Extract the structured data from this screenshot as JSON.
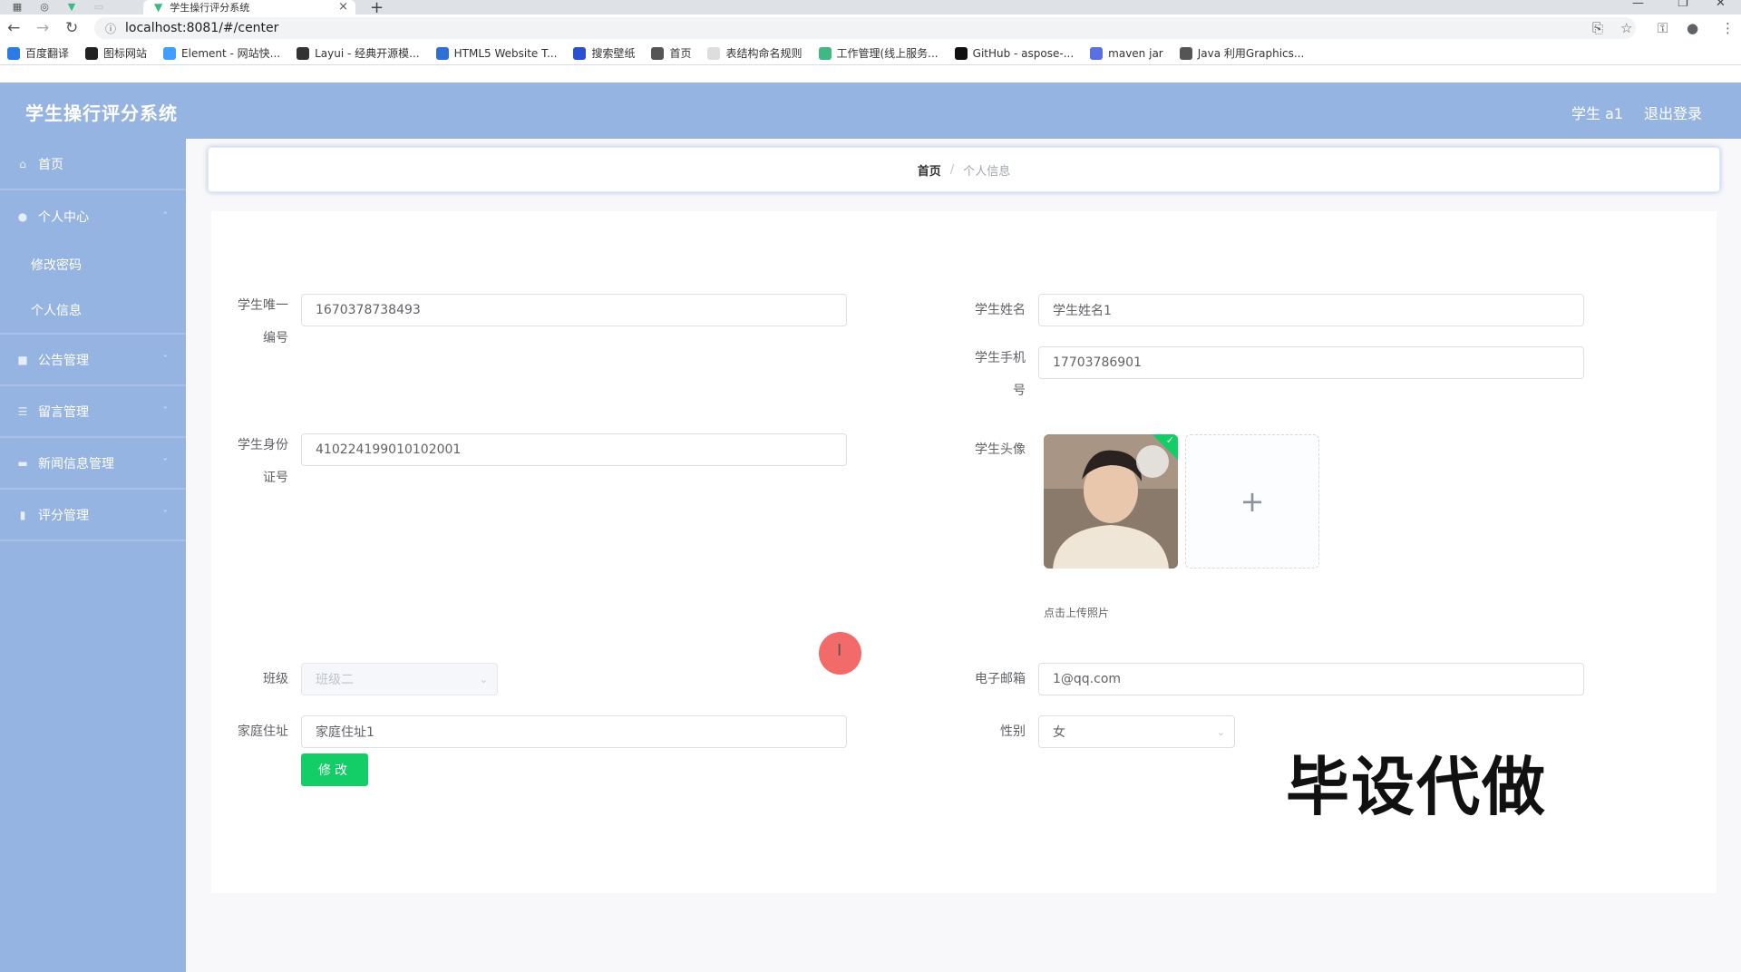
{
  "browser": {
    "tab_title": "学生操行评分系统",
    "url": "localhost:8081/#/center",
    "bookmarks": [
      {
        "label": "百度翻译",
        "icon": "translate-icon",
        "color": "#2c7be5"
      },
      {
        "label": "图标网站",
        "icon": "image-icon",
        "color": "#222222"
      },
      {
        "label": "Element - 网站快...",
        "icon": "element-icon",
        "color": "#409eff"
      },
      {
        "label": "Layui - 经典开源模...",
        "icon": "layui-icon",
        "color": "#333333"
      },
      {
        "label": "HTML5 Website T...",
        "icon": "html5-icon",
        "color": "#2f6fd6"
      },
      {
        "label": "搜索壁纸",
        "icon": "wallpaper-icon",
        "color": "#2a4fcf"
      },
      {
        "label": "首页",
        "icon": "globe-icon",
        "color": "#555555"
      },
      {
        "label": "表结构命名规则",
        "icon": "page-icon",
        "color": "#dddddd"
      },
      {
        "label": "工作管理(线上服务...",
        "icon": "vue-icon",
        "color": "#41b883"
      },
      {
        "label": "GitHub - aspose-...",
        "icon": "github-icon",
        "color": "#111111"
      },
      {
        "label": "maven jar",
        "icon": "hexagon-icon",
        "color": "#5a6fe0"
      },
      {
        "label": "Java 利用Graphics...",
        "icon": "globe-icon",
        "color": "#555555"
      }
    ]
  },
  "header": {
    "title": "学生操行评分系统",
    "user": "学生 a1",
    "logout": "退出登录",
    "bg_color": "#96b4e1"
  },
  "sidebar": {
    "items": [
      {
        "label": "首页",
        "icon": "home-icon"
      },
      {
        "label": "个人中心",
        "icon": "user-icon",
        "children": [
          "修改密码",
          "个人信息"
        ]
      },
      {
        "label": "公告管理",
        "icon": "notice-icon"
      },
      {
        "label": "留言管理",
        "icon": "list-icon"
      },
      {
        "label": "新闻信息管理",
        "icon": "news-icon"
      },
      {
        "label": "评分管理",
        "icon": "score-icon"
      }
    ]
  },
  "breadcrumb": {
    "home": "首页",
    "separator": "/",
    "current": "个人信息"
  },
  "form": {
    "student_id": {
      "label_line1": "学生唯一",
      "label_line2": "编号",
      "value": "1670378738493"
    },
    "student_name": {
      "label": "学生姓名",
      "value": "学生姓名1"
    },
    "student_phone": {
      "label_line1": "学生手机",
      "label_line2": "号",
      "value": "17703786901"
    },
    "id_card": {
      "label_line1": "学生身份",
      "label_line2": "证号",
      "value": "410224199010102001"
    },
    "avatar": {
      "label": "学生头像",
      "upload_tip": "点击上传照片",
      "plus": "+"
    },
    "class": {
      "label": "班级",
      "value": "班级二"
    },
    "email": {
      "label": "电子邮箱",
      "value": "1@qq.com"
    },
    "address": {
      "label": "家庭住址",
      "value": "家庭住址1"
    },
    "gender": {
      "label": "性别",
      "value": "女"
    },
    "submit": "修改"
  },
  "watermark": "毕设代做",
  "colors": {
    "accent": "#13ce66",
    "sidebar": "#96b4e1"
  }
}
